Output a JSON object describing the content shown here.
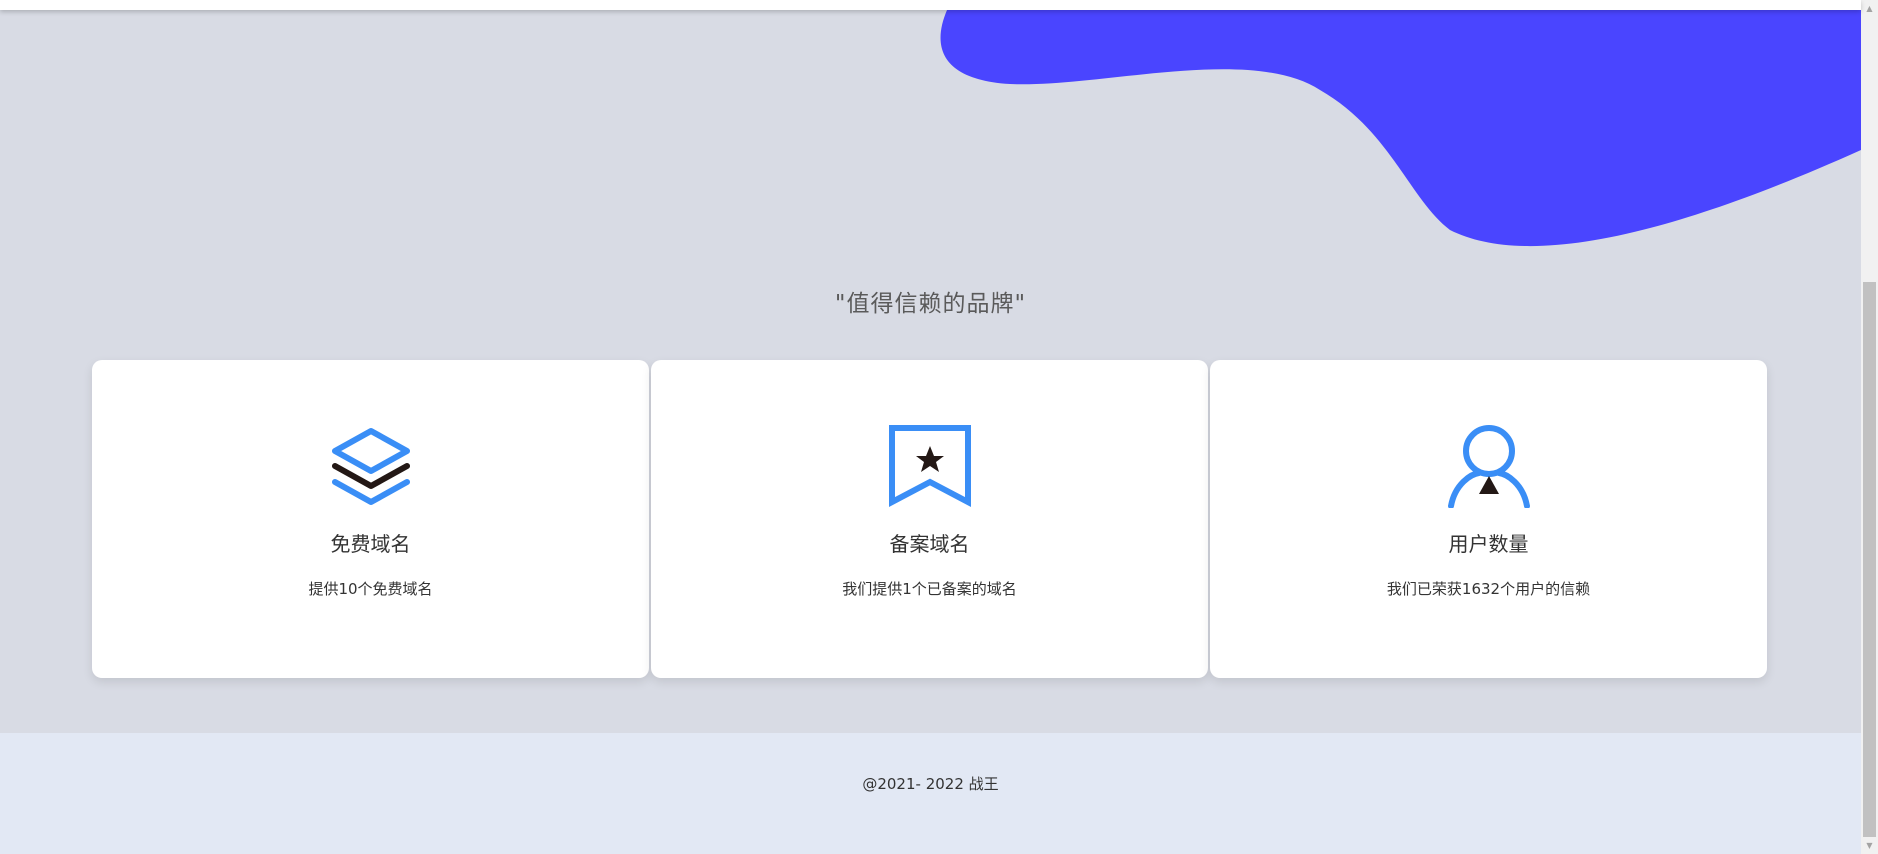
{
  "hero": {
    "section_title": "\"值得信赖的品牌\""
  },
  "colors": {
    "blob": "#4a45ff",
    "icon_blue": "#3a8ef6",
    "icon_dark": "#231815",
    "background": "#d8dbe4",
    "footer_bg": "#e2e8f4"
  },
  "cards": [
    {
      "icon": "layers-icon",
      "title": "免费域名",
      "desc": "提供10个免费域名"
    },
    {
      "icon": "bookmark-star-icon",
      "title": "备案域名",
      "desc": "我们提供1个已备案的域名"
    },
    {
      "icon": "user-icon",
      "title": "用户数量",
      "desc": "我们已荣获1632个用户的信赖"
    }
  ],
  "footer": {
    "copyright": "@2021- 2022 战王"
  }
}
